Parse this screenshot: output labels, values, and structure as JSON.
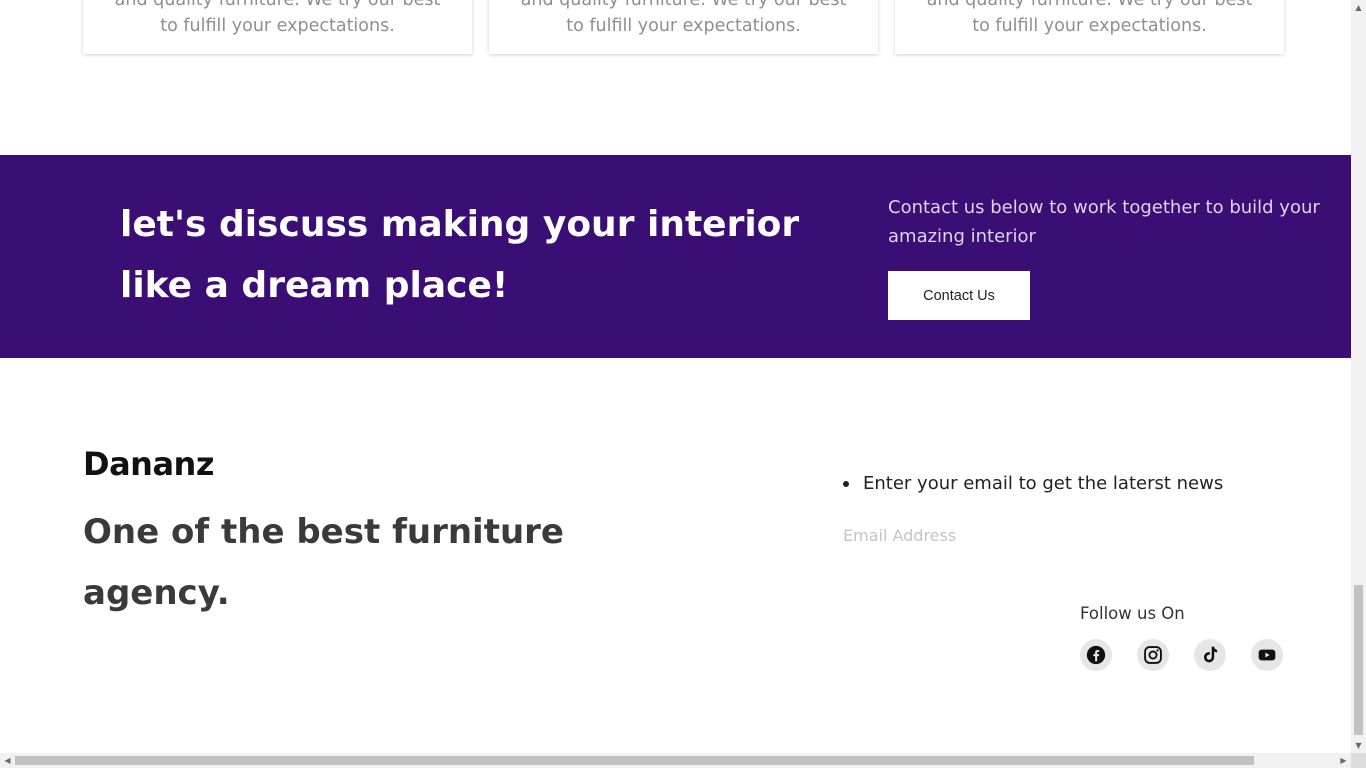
{
  "cards": [
    {
      "line1": "and quality furniture. We try our best",
      "line2": "to fulfill your expectations."
    },
    {
      "line1": "and quality furniture. We try our best",
      "line2": "to fulfill your expectations."
    },
    {
      "line1": "and quality furniture. We try our best",
      "line2": "to fulfill your expectations."
    }
  ],
  "cta": {
    "heading": "let's discuss making your interior like a dream place!",
    "text": "Contact us below to work together to build your amazing interior",
    "button_label": "Contact Us",
    "background_color": "#3b0e76"
  },
  "footer": {
    "brand": "Dananz",
    "tagline": "One of the best furniture agency.",
    "newsletter_text": "Enter your email to get the laterst news",
    "email_placeholder": "Email Address",
    "follow_label": "Follow us On",
    "social_icons": [
      "facebook-icon",
      "instagram-icon",
      "tiktok-icon",
      "youtube-icon"
    ]
  },
  "scrollbars": {
    "vertical_position": 0.95,
    "horizontal_position": 0.0
  }
}
